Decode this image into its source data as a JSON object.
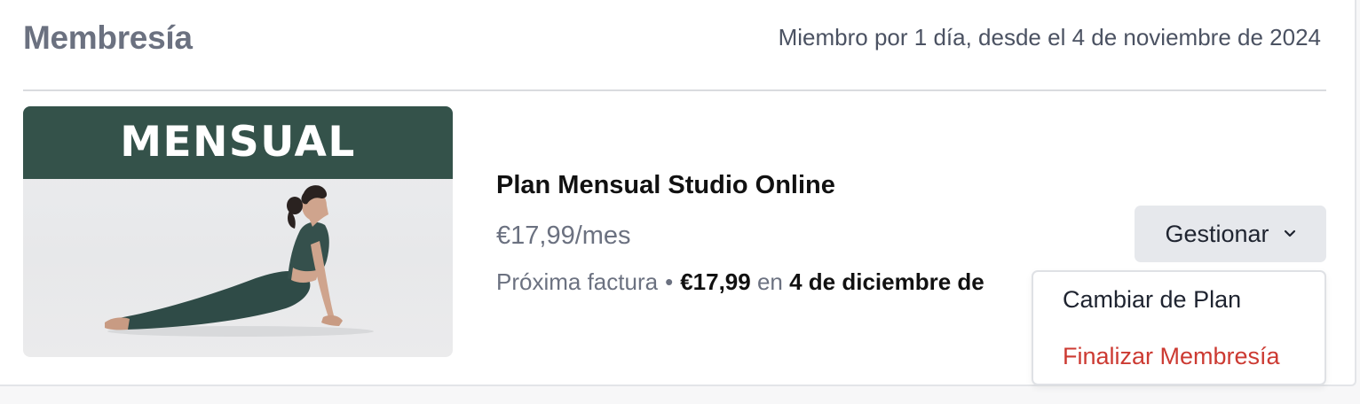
{
  "membership": {
    "title": "Membresía",
    "member_since": "Miembro por 1 día, desde el 4 de noviembre de 2024"
  },
  "plan": {
    "image_banner": "MENSUAL",
    "name": "Plan Mensual Studio Online",
    "price": "€17,99/mes",
    "next_invoice_label": "Próxima factura",
    "separator": "•",
    "next_invoice_amount": "€17,99",
    "next_invoice_connector": "en",
    "next_invoice_date": "4 de diciembre de"
  },
  "manage": {
    "label": "Gestionar",
    "icon": "chevron-down-icon",
    "menu": {
      "change_plan": "Cambiar de Plan",
      "end_membership": "Finalizar Membresía"
    }
  },
  "colors": {
    "banner": "#34524a",
    "danger": "#cc3a32",
    "title_gray": "#6b7180",
    "button_bg": "#e6e8ec"
  }
}
